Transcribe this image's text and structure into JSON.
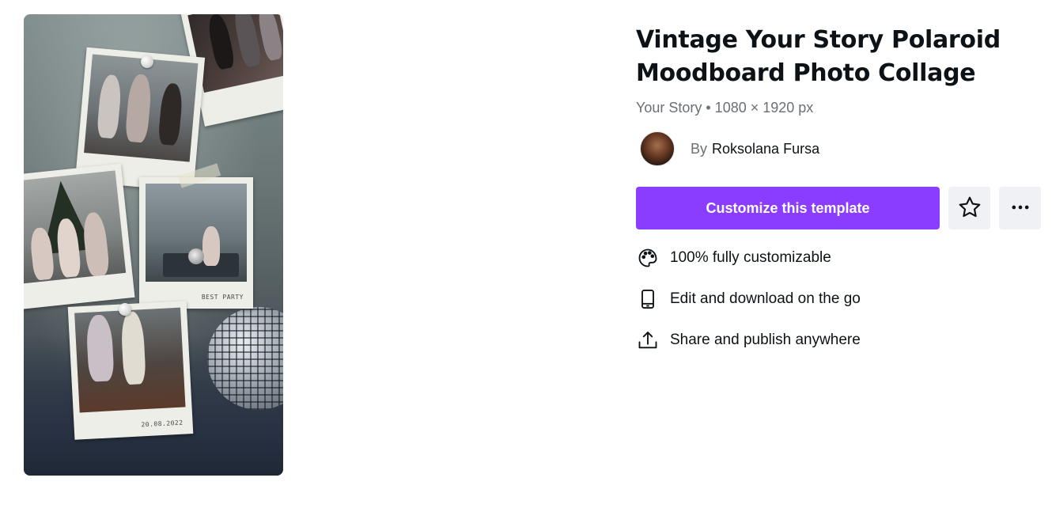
{
  "template": {
    "title": "Vintage Your Story Polaroid Moodboard Photo Collage",
    "meta": "Your Story • 1080 × 1920 px",
    "author_prefix": "By",
    "author_name": "Roksolana Fursa"
  },
  "preview": {
    "captions": [
      "BEST PARTY",
      "20.08.2022"
    ]
  },
  "actions": {
    "customize_label": "Customize this template",
    "favorite_icon": "star-icon",
    "more_icon": "more-horizontal-icon"
  },
  "features": [
    {
      "icon": "palette-icon",
      "label": "100% fully customizable"
    },
    {
      "icon": "phone-icon",
      "label": "Edit and download on the go"
    },
    {
      "icon": "upload-icon",
      "label": "Share and publish anywhere"
    }
  ],
  "colors": {
    "primary": "#8b3dff",
    "icon_button_bg": "#f0f1f5",
    "text": "#0d1216",
    "muted_text": "#6b6f76"
  }
}
